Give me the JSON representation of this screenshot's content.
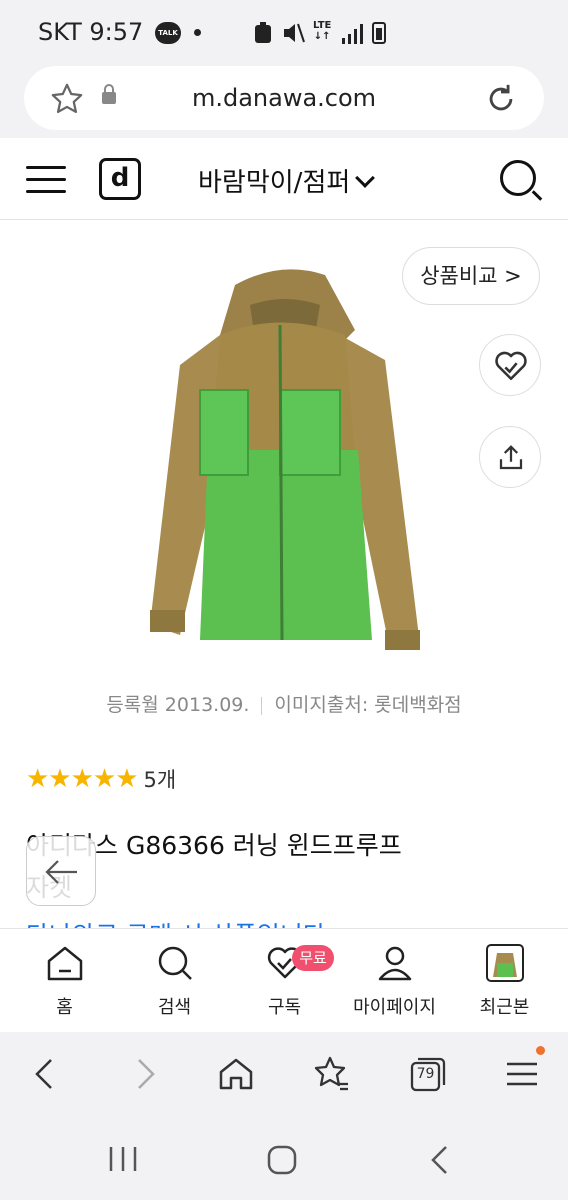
{
  "status_bar": {
    "carrier_time": "SKT 9:57",
    "talk_badge": "TALK",
    "network": "LTE"
  },
  "browser": {
    "url": "m.danawa.com"
  },
  "site_header": {
    "logo": "d",
    "category": "바람막이/점퍼"
  },
  "product": {
    "compare_label": "상품비교 >",
    "reg_date": "등록월 2013.09.",
    "image_source": "이미지출처: 롯데백화점",
    "stars": "★★★★★",
    "rating_count": "5개",
    "name_line1": "아디다스 G86366 러닝 윈드프루프",
    "name_line2": "자켓",
    "peek_text": "다나와로 구매 시 상품입니다"
  },
  "tab_bar": {
    "items": [
      {
        "label": "홈",
        "icon": "home-icon"
      },
      {
        "label": "검색",
        "icon": "search-icon"
      },
      {
        "label": "구독",
        "icon": "heart-check-icon"
      },
      {
        "label": "마이페이지",
        "icon": "person-icon"
      },
      {
        "label": "최근본",
        "icon": "recent-thumbnail"
      }
    ],
    "free_badge": "무료"
  },
  "browser_nav": {
    "tabs_count": "79"
  },
  "colors": {
    "star": "#f7b500",
    "badge": "#f04f6e",
    "jacket_brown": "#a0874a",
    "jacket_green": "#5cc054"
  }
}
